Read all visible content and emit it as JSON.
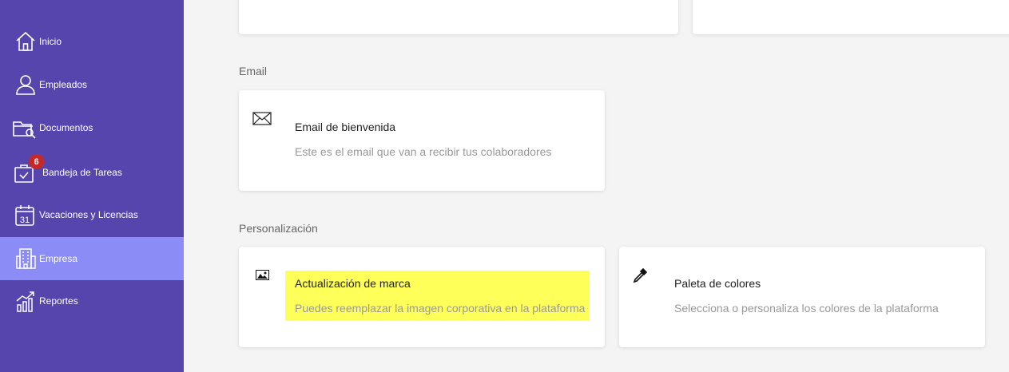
{
  "sidebar": {
    "items": [
      {
        "label": "Inicio",
        "icon": "home-icon"
      },
      {
        "label": "Empleados",
        "icon": "user-icon"
      },
      {
        "label": "Documentos",
        "icon": "folder-search-icon"
      },
      {
        "label": "Bandeja de Tareas",
        "icon": "task-bag-icon",
        "badge": "6"
      },
      {
        "label": "Vacaciones y Licencias",
        "icon": "calendar-icon"
      },
      {
        "label": "Empresa",
        "icon": "building-icon",
        "active": true
      },
      {
        "label": "Reportes",
        "icon": "chart-growth-icon"
      }
    ]
  },
  "sections": {
    "email": {
      "title": "Email",
      "cards": [
        {
          "icon": "envelope-icon",
          "title": "Email de bienvenida",
          "description": "Este es el email que van a recibir tus colaboradores"
        }
      ]
    },
    "personalizacion": {
      "title": "Personalización",
      "cards": [
        {
          "icon": "image-icon",
          "title": "Actualización de marca",
          "description": "Puedes reemplazar la imagen corporativa en la plataforma",
          "highlighted": true
        },
        {
          "icon": "eyedropper-icon",
          "title": "Paleta de colores",
          "description": "Selecciona o personaliza los colores de la plataforma"
        }
      ]
    }
  },
  "colors": {
    "sidebar_bg": "#5645ac",
    "sidebar_active": "#8b8cf6",
    "badge": "#c62828",
    "highlight": "#ffff59"
  }
}
